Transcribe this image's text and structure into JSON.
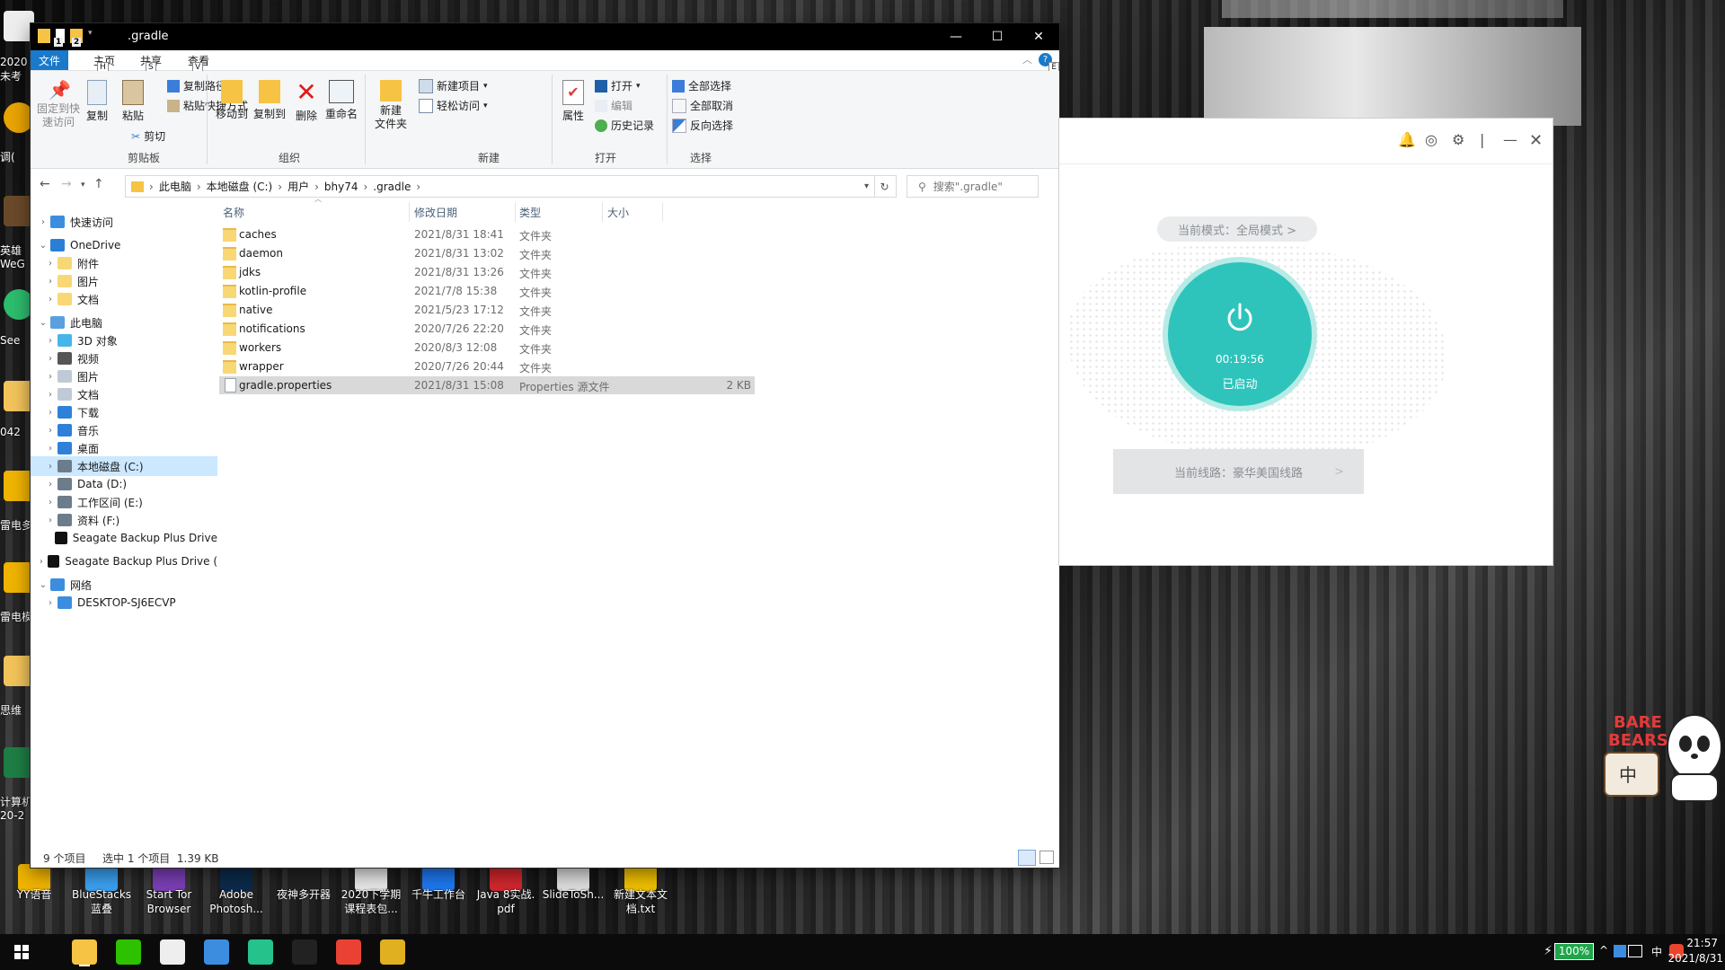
{
  "explorer": {
    "title": ".gradle",
    "qa_badges": [
      "1",
      "2"
    ],
    "window_buttons": {
      "minimize": "—",
      "maximize": "☐",
      "close": "✕"
    },
    "tabs": {
      "file": "文件",
      "home": "主页",
      "share": "共享",
      "view": "查看"
    },
    "key_tips": {
      "home": "H",
      "share": "S",
      "view": "V",
      "help": "E"
    },
    "ribbon": {
      "pin": "固定到快\n速访问",
      "copy": "复制",
      "paste": "粘贴",
      "copy_path": "复制路径",
      "paste_shortcut": "粘贴快捷方式",
      "cut": "剪切",
      "group_clipboard": "剪贴板",
      "move_to": "移动到",
      "copy_to": "复制到",
      "delete": "删除",
      "rename": "重命名",
      "group_organize": "组织",
      "new_folder": "新建\n文件夹",
      "new_item": "新建项目",
      "easy_access": "轻松访问",
      "group_new": "新建",
      "properties": "属性",
      "open": "打开",
      "edit": "编辑",
      "history": "历史记录",
      "group_open": "打开",
      "select_all": "全部选择",
      "select_none": "全部取消",
      "invert_selection": "反向选择",
      "group_select": "选择"
    },
    "breadcrumb": [
      "此电脑",
      "本地磁盘 (C:)",
      "用户",
      "bhy74",
      ".gradle"
    ],
    "search_placeholder": "搜索\".gradle\"",
    "nav": [
      {
        "label": "快速访问",
        "color": "#3c8de0"
      },
      {
        "label": "OneDrive",
        "color": "#2a7fd4"
      },
      {
        "label": "附件",
        "color": "#f8d775"
      },
      {
        "label": "图片",
        "color": "#f8d775"
      },
      {
        "label": "文档",
        "color": "#f8d775"
      },
      {
        "label": "此电脑",
        "color": "#5aa0e0"
      },
      {
        "label": "3D 对象",
        "color": "#46b6e8"
      },
      {
        "label": "视频",
        "color": "#555"
      },
      {
        "label": "图片",
        "color": "#bfcad6"
      },
      {
        "label": "文档",
        "color": "#bfcad6"
      },
      {
        "label": "下载",
        "color": "#2f80d8"
      },
      {
        "label": "音乐",
        "color": "#2f80d8"
      },
      {
        "label": "桌面",
        "color": "#2f80d8"
      },
      {
        "label": "本地磁盘 (C:)",
        "color": "#6d7c8a"
      },
      {
        "label": "Data (D:)",
        "color": "#6d7c8a"
      },
      {
        "label": "工作区间 (E:)",
        "color": "#6d7c8a"
      },
      {
        "label": "资料 (F:)",
        "color": "#6d7c8a"
      },
      {
        "label": "Seagate Backup Plus Drive",
        "color": "#111"
      },
      {
        "label": "Seagate Backup Plus Drive (",
        "color": "#111"
      },
      {
        "label": "网络",
        "color": "#3c8de0"
      },
      {
        "label": "DESKTOP-SJ6ECVP",
        "color": "#3c8de0"
      }
    ],
    "columns": {
      "name": "名称",
      "date": "修改日期",
      "type": "类型",
      "size": "大小"
    },
    "files": [
      {
        "name": "caches",
        "date": "2021/8/31 18:41",
        "type": "文件夹",
        "size": ""
      },
      {
        "name": "daemon",
        "date": "2021/8/31 13:02",
        "type": "文件夹",
        "size": ""
      },
      {
        "name": "jdks",
        "date": "2021/8/31 13:26",
        "type": "文件夹",
        "size": ""
      },
      {
        "name": "kotlin-profile",
        "date": "2021/7/8 15:38",
        "type": "文件夹",
        "size": ""
      },
      {
        "name": "native",
        "date": "2021/5/23 17:12",
        "type": "文件夹",
        "size": ""
      },
      {
        "name": "notifications",
        "date": "2020/7/26 22:20",
        "type": "文件夹",
        "size": ""
      },
      {
        "name": "workers",
        "date": "2020/8/3 12:08",
        "type": "文件夹",
        "size": ""
      },
      {
        "name": "wrapper",
        "date": "2020/7/26 20:44",
        "type": "文件夹",
        "size": ""
      },
      {
        "name": "gradle.properties",
        "date": "2021/8/31 15:08",
        "type": "Properties 源文件",
        "size": "2 KB"
      }
    ],
    "status": {
      "count": "9 个项目",
      "selection": "选中 1 个项目  1.39 KB"
    }
  },
  "vpn": {
    "mode": "当前模式：全局模式 >",
    "timer": "00:19:56",
    "state": "已启动",
    "route": "当前线路：豪华美国线路",
    "route_arrow": ">",
    "accent": "#2ec4bb"
  },
  "desktop": {
    "left_labels": [
      "2020\n未考",
      "调(",
      "英雄\nWeG",
      "See",
      "042",
      "雷电多",
      "雷电模",
      "思维",
      "计算机\n20-2"
    ],
    "bottom_icons": [
      {
        "label": "YY语音",
        "color": "#f0b400"
      },
      {
        "label": "BlueStacks\n蓝叠",
        "color": "#3aa0f0"
      },
      {
        "label": "Start Tor\nBrowser",
        "color": "#7b3fb6"
      },
      {
        "label": "Adobe\nPhotosh...",
        "color": "#0b2a4a"
      },
      {
        "label": "夜神多开器",
        "color": "#222"
      },
      {
        "label": "2020下学期\n课程表包...",
        "color": "#e8e8e8"
      },
      {
        "label": "千牛工作台",
        "color": "#1e78f0"
      },
      {
        "label": "Java 8实战.\npdf",
        "color": "#d0272d"
      },
      {
        "label": "SlideToSh...",
        "color": "#ddd"
      },
      {
        "label": "新建文本文\n档.txt",
        "color": "#f0c000"
      }
    ],
    "bears_sticker": {
      "text1": "BARE",
      "text2": "BEARS",
      "text3": "中"
    }
  },
  "taskbar": {
    "battery": "100%",
    "ime": "中",
    "time": "21:57",
    "date": "2021/8/31",
    "apps": [
      {
        "name": "file-explorer",
        "color": "#f6c344"
      },
      {
        "name": "wechat",
        "color": "#2dc100"
      },
      {
        "name": "typora",
        "color": "#eee"
      },
      {
        "name": "app-blue",
        "color": "#3c8de0"
      },
      {
        "name": "shield-app",
        "color": "#25c28c"
      },
      {
        "name": "terminal",
        "color": "#222"
      },
      {
        "name": "chrome",
        "color": "#e94235"
      },
      {
        "name": "yellow-app",
        "color": "#e0b020"
      }
    ]
  }
}
